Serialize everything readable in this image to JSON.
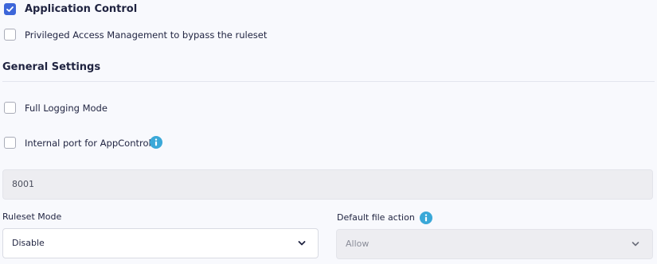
{
  "app_control": {
    "label": "Application Control",
    "checked": true
  },
  "pam_bypass": {
    "label": "Privileged Access Management to bypass the ruleset",
    "checked": false
  },
  "general_settings": {
    "title": "General Settings",
    "full_logging": {
      "label": "Full Logging Mode",
      "checked": false
    },
    "internal_port": {
      "label": "Internal port for AppControl",
      "checked": false,
      "icon": "info-icon"
    },
    "port_value": "8001"
  },
  "ruleset_mode": {
    "label": "Ruleset Mode",
    "value": "Disable"
  },
  "default_file_action": {
    "label": "Default file action",
    "value": "Allow",
    "icon": "info-icon"
  },
  "colors": {
    "accent": "#3d66d9",
    "info": "#3aa8d8",
    "text": "#1f2340"
  }
}
